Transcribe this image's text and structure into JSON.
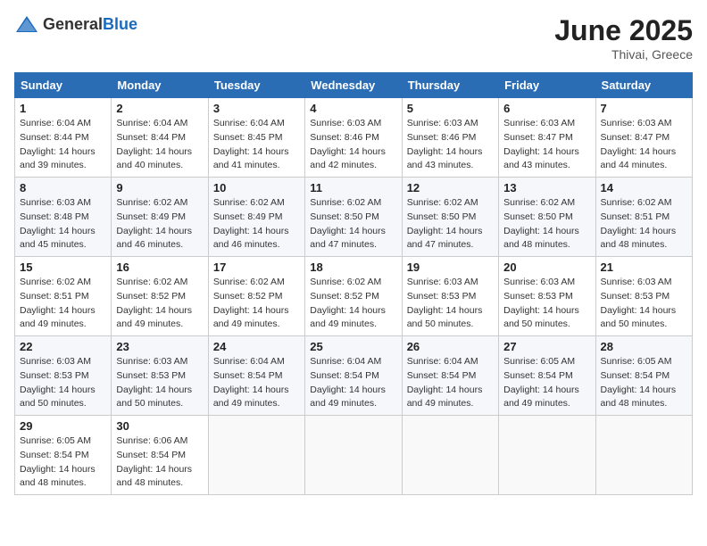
{
  "header": {
    "logo_general": "General",
    "logo_blue": "Blue",
    "month_title": "June 2025",
    "location": "Thivai, Greece"
  },
  "calendar": {
    "days_of_week": [
      "Sunday",
      "Monday",
      "Tuesday",
      "Wednesday",
      "Thursday",
      "Friday",
      "Saturday"
    ],
    "weeks": [
      [
        null,
        {
          "day": "2",
          "sunrise": "Sunrise: 6:04 AM",
          "sunset": "Sunset: 8:44 PM",
          "daylight": "Daylight: 14 hours and 40 minutes."
        },
        {
          "day": "3",
          "sunrise": "Sunrise: 6:04 AM",
          "sunset": "Sunset: 8:45 PM",
          "daylight": "Daylight: 14 hours and 41 minutes."
        },
        {
          "day": "4",
          "sunrise": "Sunrise: 6:03 AM",
          "sunset": "Sunset: 8:46 PM",
          "daylight": "Daylight: 14 hours and 42 minutes."
        },
        {
          "day": "5",
          "sunrise": "Sunrise: 6:03 AM",
          "sunset": "Sunset: 8:46 PM",
          "daylight": "Daylight: 14 hours and 43 minutes."
        },
        {
          "day": "6",
          "sunrise": "Sunrise: 6:03 AM",
          "sunset": "Sunset: 8:47 PM",
          "daylight": "Daylight: 14 hours and 43 minutes."
        },
        {
          "day": "7",
          "sunrise": "Sunrise: 6:03 AM",
          "sunset": "Sunset: 8:47 PM",
          "daylight": "Daylight: 14 hours and 44 minutes."
        }
      ],
      [
        {
          "day": "8",
          "sunrise": "Sunrise: 6:03 AM",
          "sunset": "Sunset: 8:48 PM",
          "daylight": "Daylight: 14 hours and 45 minutes."
        },
        {
          "day": "9",
          "sunrise": "Sunrise: 6:02 AM",
          "sunset": "Sunset: 8:49 PM",
          "daylight": "Daylight: 14 hours and 46 minutes."
        },
        {
          "day": "10",
          "sunrise": "Sunrise: 6:02 AM",
          "sunset": "Sunset: 8:49 PM",
          "daylight": "Daylight: 14 hours and 46 minutes."
        },
        {
          "day": "11",
          "sunrise": "Sunrise: 6:02 AM",
          "sunset": "Sunset: 8:50 PM",
          "daylight": "Daylight: 14 hours and 47 minutes."
        },
        {
          "day": "12",
          "sunrise": "Sunrise: 6:02 AM",
          "sunset": "Sunset: 8:50 PM",
          "daylight": "Daylight: 14 hours and 47 minutes."
        },
        {
          "day": "13",
          "sunrise": "Sunrise: 6:02 AM",
          "sunset": "Sunset: 8:50 PM",
          "daylight": "Daylight: 14 hours and 48 minutes."
        },
        {
          "day": "14",
          "sunrise": "Sunrise: 6:02 AM",
          "sunset": "Sunset: 8:51 PM",
          "daylight": "Daylight: 14 hours and 48 minutes."
        }
      ],
      [
        {
          "day": "15",
          "sunrise": "Sunrise: 6:02 AM",
          "sunset": "Sunset: 8:51 PM",
          "daylight": "Daylight: 14 hours and 49 minutes."
        },
        {
          "day": "16",
          "sunrise": "Sunrise: 6:02 AM",
          "sunset": "Sunset: 8:52 PM",
          "daylight": "Daylight: 14 hours and 49 minutes."
        },
        {
          "day": "17",
          "sunrise": "Sunrise: 6:02 AM",
          "sunset": "Sunset: 8:52 PM",
          "daylight": "Daylight: 14 hours and 49 minutes."
        },
        {
          "day": "18",
          "sunrise": "Sunrise: 6:02 AM",
          "sunset": "Sunset: 8:52 PM",
          "daylight": "Daylight: 14 hours and 49 minutes."
        },
        {
          "day": "19",
          "sunrise": "Sunrise: 6:03 AM",
          "sunset": "Sunset: 8:53 PM",
          "daylight": "Daylight: 14 hours and 50 minutes."
        },
        {
          "day": "20",
          "sunrise": "Sunrise: 6:03 AM",
          "sunset": "Sunset: 8:53 PM",
          "daylight": "Daylight: 14 hours and 50 minutes."
        },
        {
          "day": "21",
          "sunrise": "Sunrise: 6:03 AM",
          "sunset": "Sunset: 8:53 PM",
          "daylight": "Daylight: 14 hours and 50 minutes."
        }
      ],
      [
        {
          "day": "22",
          "sunrise": "Sunrise: 6:03 AM",
          "sunset": "Sunset: 8:53 PM",
          "daylight": "Daylight: 14 hours and 50 minutes."
        },
        {
          "day": "23",
          "sunrise": "Sunrise: 6:03 AM",
          "sunset": "Sunset: 8:53 PM",
          "daylight": "Daylight: 14 hours and 50 minutes."
        },
        {
          "day": "24",
          "sunrise": "Sunrise: 6:04 AM",
          "sunset": "Sunset: 8:54 PM",
          "daylight": "Daylight: 14 hours and 49 minutes."
        },
        {
          "day": "25",
          "sunrise": "Sunrise: 6:04 AM",
          "sunset": "Sunset: 8:54 PM",
          "daylight": "Daylight: 14 hours and 49 minutes."
        },
        {
          "day": "26",
          "sunrise": "Sunrise: 6:04 AM",
          "sunset": "Sunset: 8:54 PM",
          "daylight": "Daylight: 14 hours and 49 minutes."
        },
        {
          "day": "27",
          "sunrise": "Sunrise: 6:05 AM",
          "sunset": "Sunset: 8:54 PM",
          "daylight": "Daylight: 14 hours and 49 minutes."
        },
        {
          "day": "28",
          "sunrise": "Sunrise: 6:05 AM",
          "sunset": "Sunset: 8:54 PM",
          "daylight": "Daylight: 14 hours and 48 minutes."
        }
      ],
      [
        {
          "day": "29",
          "sunrise": "Sunrise: 6:05 AM",
          "sunset": "Sunset: 8:54 PM",
          "daylight": "Daylight: 14 hours and 48 minutes."
        },
        {
          "day": "30",
          "sunrise": "Sunrise: 6:06 AM",
          "sunset": "Sunset: 8:54 PM",
          "daylight": "Daylight: 14 hours and 48 minutes."
        },
        null,
        null,
        null,
        null,
        null
      ]
    ],
    "day1": {
      "day": "1",
      "sunrise": "Sunrise: 6:04 AM",
      "sunset": "Sunset: 8:44 PM",
      "daylight": "Daylight: 14 hours and 39 minutes."
    }
  }
}
